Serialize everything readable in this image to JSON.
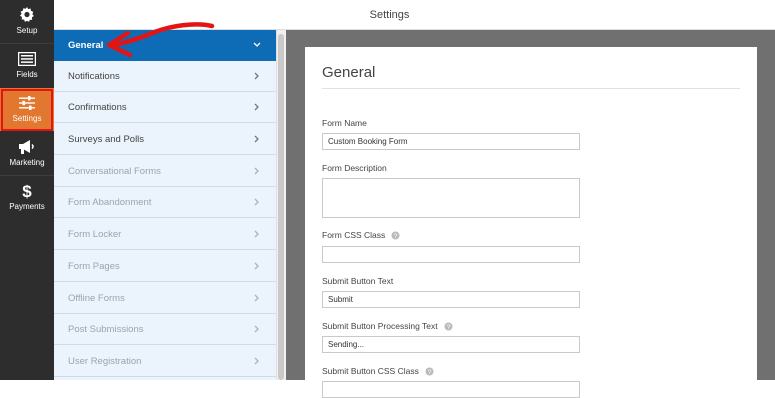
{
  "topbar": {
    "title": "Settings"
  },
  "leftnav": {
    "items": [
      {
        "label": "Setup",
        "icon": "gear-icon"
      },
      {
        "label": "Fields",
        "icon": "fields-icon"
      },
      {
        "label": "Settings",
        "icon": "sliders-icon"
      },
      {
        "label": "Marketing",
        "icon": "megaphone-icon"
      },
      {
        "label": "Payments",
        "icon": "dollar-icon"
      }
    ],
    "active": "Settings"
  },
  "subpanel": {
    "items": [
      {
        "label": "General",
        "state": "active"
      },
      {
        "label": "Notifications",
        "state": "normal"
      },
      {
        "label": "Confirmations",
        "state": "normal"
      },
      {
        "label": "Surveys and Polls",
        "state": "normal"
      },
      {
        "label": "Conversational Forms",
        "state": "disabled"
      },
      {
        "label": "Form Abandonment",
        "state": "disabled"
      },
      {
        "label": "Form Locker",
        "state": "disabled"
      },
      {
        "label": "Form Pages",
        "state": "disabled"
      },
      {
        "label": "Offline Forms",
        "state": "disabled"
      },
      {
        "label": "Post Submissions",
        "state": "disabled"
      },
      {
        "label": "User Registration",
        "state": "disabled"
      }
    ]
  },
  "general": {
    "title": "General",
    "fields": {
      "form_name": {
        "label": "Form Name",
        "value": "Custom Booking Form"
      },
      "form_description": {
        "label": "Form Description",
        "value": ""
      },
      "form_css_class": {
        "label": "Form CSS Class",
        "value": ""
      },
      "submit_text": {
        "label": "Submit Button Text",
        "value": "Submit"
      },
      "submit_processing_text": {
        "label": "Submit Button Processing Text",
        "value": "Sending..."
      },
      "submit_css_class": {
        "label": "Submit Button CSS Class",
        "value": ""
      }
    }
  },
  "colors": {
    "nav_bg": "#2d2d2d",
    "nav_active": "#e27730",
    "sub_active": "#0e6bb5",
    "annotation": "#e41414"
  }
}
